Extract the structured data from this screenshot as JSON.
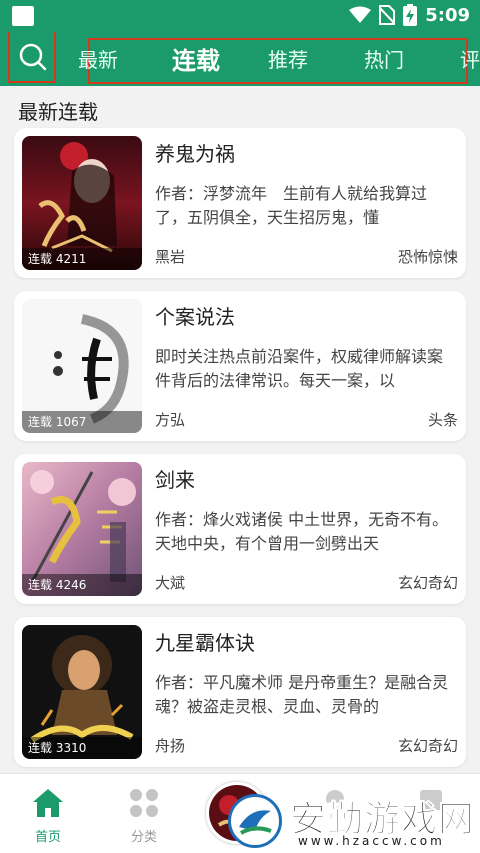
{
  "status_bar": {
    "time": "5:09"
  },
  "top_bar": {
    "tabs": [
      {
        "label": "最新",
        "active": false
      },
      {
        "label": "连载",
        "active": true
      },
      {
        "label": "推荐",
        "active": false
      },
      {
        "label": "热门",
        "active": false
      },
      {
        "label": "评",
        "active": false
      }
    ]
  },
  "section": {
    "title": "最新连载"
  },
  "books": [
    {
      "title": "养鬼为祸",
      "desc": "作者：浮梦流年　生前有人就给我算过了，五阴俱全，天生招厉鬼，懂",
      "author": "黑岩",
      "genre": "恐怖惊悚",
      "badge": "连载 4211"
    },
    {
      "title": "个案说法",
      "desc": "即时关注热点前沿案件，权威律师解读案件背后的法律常识。每天一案，以",
      "author": "方弘",
      "genre": "头条",
      "badge": "连载 1067"
    },
    {
      "title": "剑来",
      "desc": "作者：烽火戏诸侯 中土世界，无奇不有。天地中央，有个曾用一剑劈出天",
      "author": "大斌",
      "genre": "玄幻奇幻",
      "badge": "连载 4246"
    },
    {
      "title": "九星霸体诀",
      "desc": "作者：平凡魔术师 是丹帝重生？是融合灵魂？被盗走灵根、灵血、灵骨的",
      "author": "舟扬",
      "genre": "玄幻奇幻",
      "badge": "连载 3310"
    }
  ],
  "bottom_nav": {
    "home_label": "首页",
    "category_label": "分类"
  },
  "watermark": {
    "text": "安勤游戏网",
    "url": "www.hzaccw.com"
  },
  "colors": {
    "primary": "#1b9b6b",
    "highlight_box": "#d23a1e"
  }
}
